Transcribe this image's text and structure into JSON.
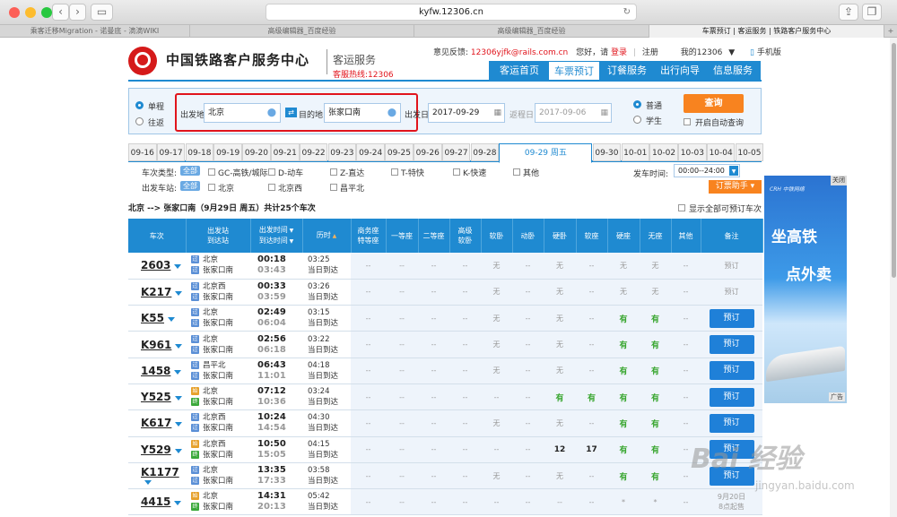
{
  "browser": {
    "url": "kyfw.12306.cn",
    "tabs": [
      "乘客迁移Migration - 诺曼底 - 滴滴WIKI",
      "高级编辑器_百度经验",
      "高级编辑器_百度经验",
      "车票预订 | 客运服务 | 铁路客户服务中心"
    ]
  },
  "header": {
    "logo_title": "中国铁路客户服务中心",
    "sub_title": "客运服务",
    "hotline": "客服热线:12306",
    "feedback_label": "意见反馈:",
    "feedback_email": "12306yjfk@rails.com.cn",
    "greeting": "您好，请",
    "login": "登录",
    "register": "注册",
    "my12306": "我的12306",
    "mobile": "手机版",
    "nav": [
      "客运首页",
      "车票预订",
      "订餐服务",
      "出行向导",
      "信息服务"
    ]
  },
  "search": {
    "oneway": "单程",
    "roundtrip": "往返",
    "from_label": "出发地",
    "from_value": "北京",
    "to_label": "目的地",
    "to_value": "张家口南",
    "depart_label": "出发日",
    "depart_value": "2017-09-29",
    "return_label": "返程日",
    "return_value": "2017-09-06",
    "normal": "普通",
    "student": "学生",
    "query_button": "查询",
    "auto_query": "开启自动查询"
  },
  "dates": [
    "09-16",
    "09-17",
    "09-18",
    "09-19",
    "09-20",
    "09-21",
    "09-22",
    "09-23",
    "09-24",
    "09-25",
    "09-26",
    "09-27",
    "09-28",
    "09-29 周五",
    "09-30",
    "10-01",
    "10-02",
    "10-03",
    "10-04",
    "10-05"
  ],
  "filters": {
    "type_label": "车次类型:",
    "all": "全部",
    "types": [
      "GC-高铁/城际",
      "D-动车",
      "Z-直达",
      "T-特快",
      "K-快速",
      "其他"
    ],
    "station_label": "出发车站:",
    "stations": [
      "北京",
      "北京西",
      "昌平北"
    ],
    "time_label": "发车时间:",
    "time_value": "00:00--24:00",
    "helper": "订票助手"
  },
  "summary": {
    "route": "北京 --> 张家口南（9月29日  周五）共计25个车次",
    "show_all": "显示全部可预订车次"
  },
  "table_headers": [
    "车次",
    "出发站\n到达站",
    "出发时间\n到达时间",
    "历时",
    "商务座\n特等座",
    "一等座",
    "二等座",
    "高级\n软卧",
    "软卧",
    "动卧",
    "硬卧",
    "软座",
    "硬座",
    "无座",
    "其他",
    "备注"
  ],
  "trains": [
    {
      "no": "2603",
      "from": "北京",
      "to": "张家口南",
      "dep": "00:18",
      "arr": "03:43",
      "dur": "03:25",
      "day": "当日到达",
      "icon": "过",
      "seats": [
        "--",
        "--",
        "--",
        "--",
        "无",
        "--",
        "无",
        "--",
        "无",
        "无",
        "--"
      ],
      "action": "预订",
      "bookable": false
    },
    {
      "no": "K217",
      "from": "北京西",
      "to": "张家口南",
      "dep": "00:33",
      "arr": "03:59",
      "dur": "03:26",
      "day": "当日到达",
      "icon": "过",
      "seats": [
        "--",
        "--",
        "--",
        "--",
        "无",
        "--",
        "无",
        "--",
        "无",
        "无",
        "--"
      ],
      "action": "预订",
      "bookable": false
    },
    {
      "no": "K55",
      "from": "北京",
      "to": "张家口南",
      "dep": "02:49",
      "arr": "06:04",
      "dur": "03:15",
      "day": "当日到达",
      "icon": "过",
      "seats": [
        "--",
        "--",
        "--",
        "--",
        "无",
        "--",
        "无",
        "--",
        "有",
        "有",
        "--"
      ],
      "action": "预订",
      "bookable": true
    },
    {
      "no": "K961",
      "from": "北京",
      "to": "张家口南",
      "dep": "02:56",
      "arr": "06:18",
      "dur": "03:22",
      "day": "当日到达",
      "icon": "过",
      "seats": [
        "--",
        "--",
        "--",
        "--",
        "无",
        "--",
        "无",
        "--",
        "有",
        "有",
        "--"
      ],
      "action": "预订",
      "bookable": true
    },
    {
      "no": "1458",
      "from": "昌平北",
      "to": "张家口南",
      "dep": "06:43",
      "arr": "11:01",
      "dur": "04:18",
      "day": "当日到达",
      "icon": "过",
      "seats": [
        "--",
        "--",
        "--",
        "--",
        "无",
        "--",
        "无",
        "--",
        "有",
        "有",
        "--"
      ],
      "action": "预订",
      "bookable": true
    },
    {
      "no": "Y525",
      "from": "北京",
      "to": "张家口南",
      "dep": "07:12",
      "arr": "10:36",
      "dur": "03:24",
      "day": "当日到达",
      "icon": "始",
      "seats": [
        "--",
        "--",
        "--",
        "--",
        "--",
        "--",
        "有",
        "有",
        "有",
        "有",
        "--"
      ],
      "action": "预订",
      "bookable": true
    },
    {
      "no": "K617",
      "from": "北京西",
      "to": "张家口南",
      "dep": "10:24",
      "arr": "14:54",
      "dur": "04:30",
      "day": "当日到达",
      "icon": "过",
      "seats": [
        "--",
        "--",
        "--",
        "--",
        "无",
        "--",
        "无",
        "--",
        "有",
        "有",
        "--"
      ],
      "action": "预订",
      "bookable": true
    },
    {
      "no": "Y529",
      "from": "北京西",
      "to": "张家口南",
      "dep": "10:50",
      "arr": "15:05",
      "dur": "04:15",
      "day": "当日到达",
      "icon": "始",
      "seats": [
        "--",
        "--",
        "--",
        "--",
        "--",
        "--",
        "12",
        "17",
        "有",
        "有",
        "--"
      ],
      "action": "预订",
      "bookable": true
    },
    {
      "no": "K1177",
      "from": "北京",
      "to": "张家口南",
      "dep": "13:35",
      "arr": "17:33",
      "dur": "03:58",
      "day": "当日到达",
      "icon": "过",
      "seats": [
        "--",
        "--",
        "--",
        "--",
        "无",
        "--",
        "无",
        "--",
        "有",
        "有",
        "--"
      ],
      "action": "预订",
      "bookable": true
    },
    {
      "no": "4415",
      "from": "北京",
      "to": "张家口南",
      "dep": "14:31",
      "arr": "20:13",
      "dur": "05:42",
      "day": "当日到达",
      "icon": "始",
      "seats": [
        "--",
        "--",
        "--",
        "--",
        "--",
        "--",
        "--",
        "--",
        "*",
        "*",
        "--"
      ],
      "action": "9月20日\n8点起售",
      "bookable": false
    }
  ],
  "ad": {
    "brand": "CRH 中铁网络",
    "line1": "坐高铁",
    "line2": "点外卖",
    "close": "关闭",
    "tag": "广告"
  },
  "watermark": {
    "text": "Bai 经验",
    "url": "jingyan.baidu.com"
  },
  "colors": {
    "accent": "#1f8ad1",
    "highlight": "#e1141c",
    "query": "#f8831f",
    "available": "#37a52e"
  }
}
